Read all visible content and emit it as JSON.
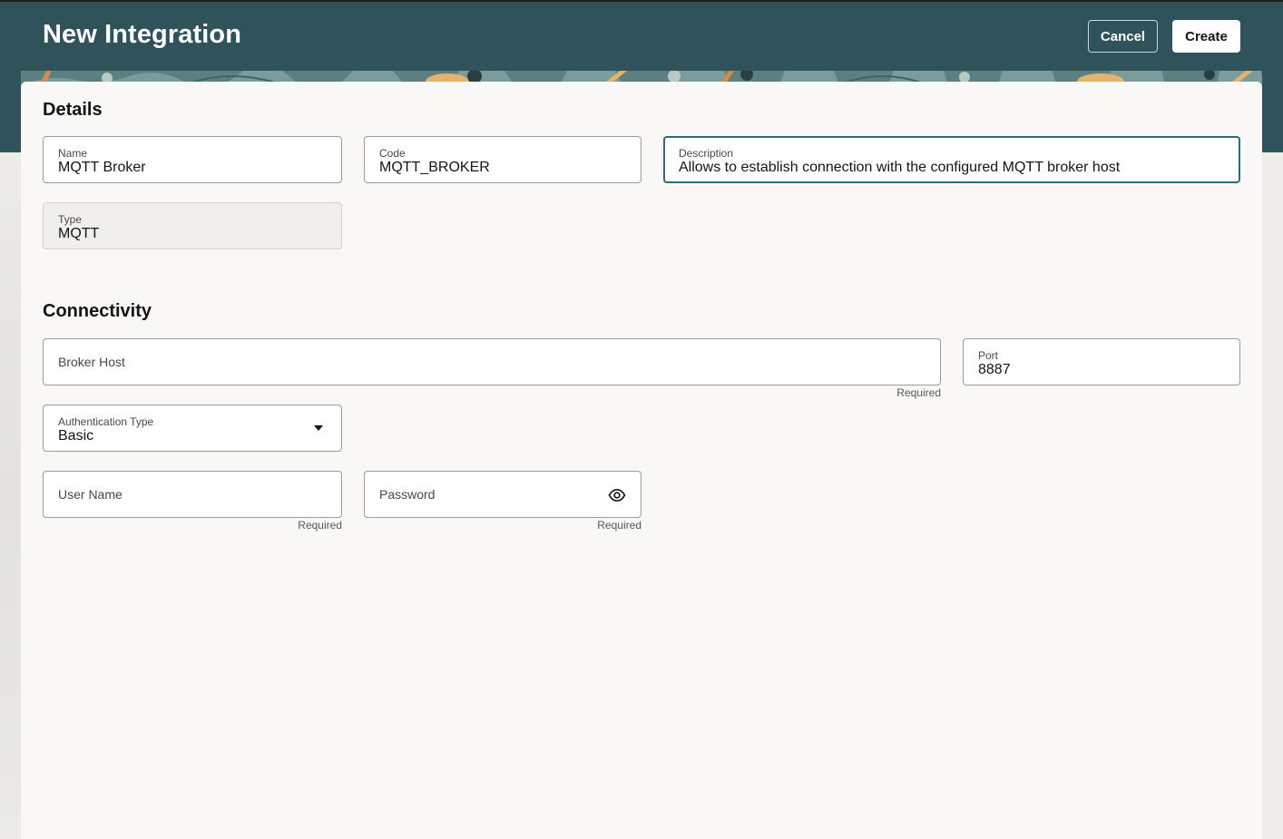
{
  "header": {
    "title": "New Integration",
    "cancel_label": "Cancel",
    "create_label": "Create"
  },
  "details": {
    "section_title": "Details",
    "name": {
      "label": "Name",
      "value": "MQTT Broker"
    },
    "code": {
      "label": "Code",
      "value": "MQTT_BROKER"
    },
    "description": {
      "label": "Description",
      "value": "Allows to establish connection with the configured MQTT broker host"
    },
    "type": {
      "label": "Type",
      "value": "MQTT"
    }
  },
  "connectivity": {
    "section_title": "Connectivity",
    "broker_host": {
      "placeholder": "Broker Host",
      "helper": "Required"
    },
    "port": {
      "label": "Port",
      "value": "8887"
    },
    "auth_type": {
      "label": "Authentication Type",
      "value": "Basic"
    },
    "user_name": {
      "placeholder": "User Name",
      "helper": "Required"
    },
    "password": {
      "placeholder": "Password",
      "helper": "Required"
    }
  },
  "icons": {
    "auth_dropdown": "chevron-down-icon",
    "password_toggle": "eye-icon"
  },
  "colors": {
    "header_bg": "#30535b",
    "card_bg": "#f9f8f6",
    "focus_border": "#2d6a7e"
  }
}
